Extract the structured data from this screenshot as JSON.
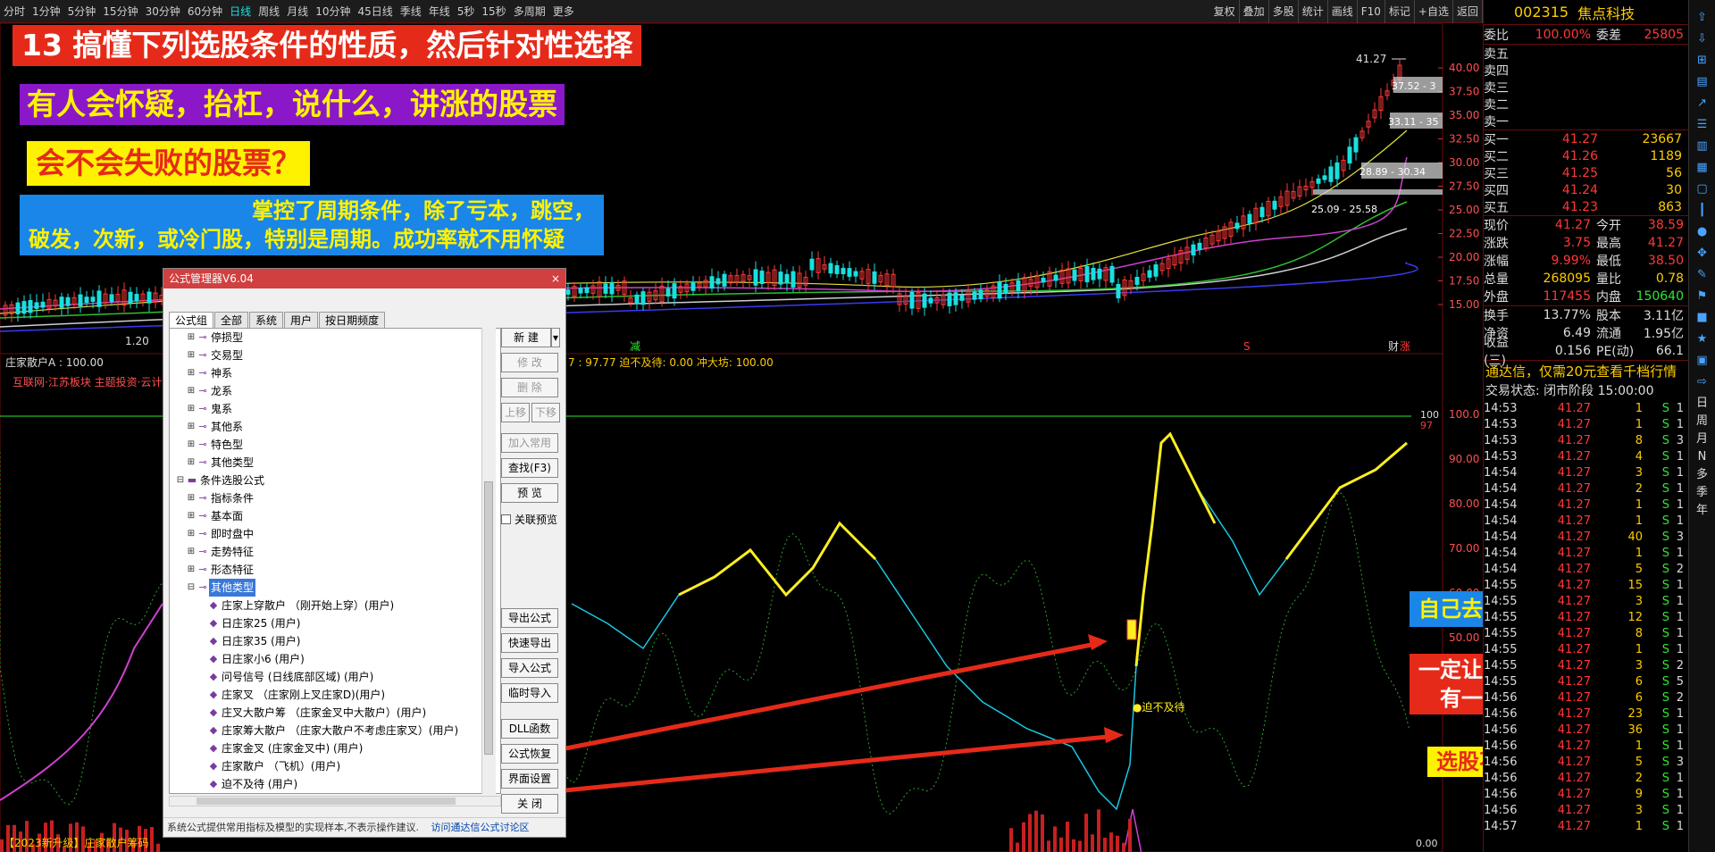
{
  "toolbar": {
    "periods": [
      "分时",
      "1分钟",
      "5分钟",
      "15分钟",
      "30分钟",
      "60分钟",
      "日线",
      "周线",
      "月线",
      "10分钟",
      "45日线",
      "季线",
      "年线",
      "5秒",
      "15秒",
      "多周期",
      "更多"
    ],
    "active_period": "日线",
    "right": [
      "复权",
      "叠加",
      "多股",
      "统计",
      "画线",
      "F10",
      "标记",
      "+自选",
      "返回"
    ]
  },
  "banners": {
    "b1": "13 搞懂下列选股条件的性质，然后针对性选择",
    "b2": "有人会怀疑，抬杠，说什么，讲涨的股票",
    "b3": "会不会失败的股票？",
    "b4_line1": "掌控了周期条件，除了亏本，跳空，",
    "b4_line2": "破发，次新，或冷门股，特别是周期。成功率就不用怀疑",
    "b5": "自己去下载  学习吧",
    "b6_line1": "一定让你对股票筹码",
    "b6_line2": "有一个全新的认识",
    "b7": "选股不再难！！！"
  },
  "chart_labels": {
    "price_axis": [
      "40.00",
      "37.50",
      "35.00",
      "32.50",
      "30.00",
      "27.50",
      "25.00",
      "22.50",
      "20.00",
      "17.50",
      "15.00"
    ],
    "osc_axis": [
      "100.0",
      "90.00",
      "80.00",
      "70.00",
      "60.00",
      "50.00"
    ],
    "high_label": "41.27",
    "zone1": "37.52 - 3",
    "zone2": "33.11 - 35",
    "zone3": "28.89 - 30.34",
    "zone4": "25.09 - 25.58",
    "low_label": "1.20",
    "indicator_name": "庄家散户A : 100.00",
    "indicator_values": "7 : 97.77   迫不及待: 0.00   冲大坊: 100.00",
    "sector": "互联网·江苏板块 主题投资·云计",
    "marker_jian": "减",
    "marker_s": "S",
    "marker_cai": "财",
    "marker_zhang": "涨",
    "annotation": "●迫不及待",
    "level_100": "100",
    "level_97": "97",
    "zero_label": "0.00",
    "bottom_tab": "【2023新升级】庄家散户筹码"
  },
  "dialog": {
    "title": "公式管理器V6.04",
    "close": "×",
    "tabs": [
      "公式组",
      "全部",
      "系统",
      "用户",
      "按日期频度"
    ],
    "tree": [
      {
        "label": "停损型",
        "level": 1,
        "type": "node"
      },
      {
        "label": "交易型",
        "level": 1,
        "type": "node"
      },
      {
        "label": "神系",
        "level": 1,
        "type": "node"
      },
      {
        "label": "龙系",
        "level": 1,
        "type": "node"
      },
      {
        "label": "鬼系",
        "level": 1,
        "type": "node"
      },
      {
        "label": "其他系",
        "level": 1,
        "type": "node"
      },
      {
        "label": "特色型",
        "level": 1,
        "type": "node"
      },
      {
        "label": "其他类型",
        "level": 1,
        "type": "node"
      },
      {
        "label": "条件选股公式",
        "level": 0,
        "type": "folder"
      },
      {
        "label": "指标条件",
        "level": 1,
        "type": "node"
      },
      {
        "label": "基本面",
        "level": 1,
        "type": "node"
      },
      {
        "label": "即时盘中",
        "level": 1,
        "type": "node"
      },
      {
        "label": "走势特征",
        "level": 1,
        "type": "node"
      },
      {
        "label": "形态特征",
        "level": 1,
        "type": "node"
      },
      {
        "label": "其他类型",
        "level": 1,
        "type": "node",
        "selected": true
      },
      {
        "label": "庄家上穿散户  （刚开始上穿）(用户)",
        "level": 2,
        "type": "leaf"
      },
      {
        "label": "日庄家25  (用户)",
        "level": 2,
        "type": "leaf"
      },
      {
        "label": "日庄家35  (用户)",
        "level": 2,
        "type": "leaf"
      },
      {
        "label": "日庄家小6  (用户)",
        "level": 2,
        "type": "leaf"
      },
      {
        "label": "问号信号  (日线底部区域)  (用户)",
        "level": 2,
        "type": "leaf"
      },
      {
        "label": "庄家叉  （庄家刚上叉庄家D)(用户)",
        "level": 2,
        "type": "leaf"
      },
      {
        "label": "庄叉大散户筹  （庄家金叉中大散户）(用户)",
        "level": 2,
        "type": "leaf"
      },
      {
        "label": "庄家筹大散户  （庄家大散户不考虑庄家叉）(用户)",
        "level": 2,
        "type": "leaf"
      },
      {
        "label": "庄家金叉  (庄家金叉中)  (用户)",
        "level": 2,
        "type": "leaf"
      },
      {
        "label": "庄家散户  （飞机）(用户)",
        "level": 2,
        "type": "leaf"
      },
      {
        "label": "迫不及待  (用户)",
        "level": 2,
        "type": "leaf"
      }
    ],
    "buttons": {
      "new": "新 建",
      "modify": "修 改",
      "delete": "删 除",
      "up": "上移",
      "down": "下移",
      "add_common": "加入常用",
      "find": "查找(F3)",
      "preview": "预 览",
      "link_preview": "关联预览",
      "export": "导出公式",
      "quick_export": "快速导出",
      "import": "导入公式",
      "temp_import": "临时导入",
      "dll": "DLL函数",
      "restore": "公式恢复",
      "ui_settings": "界面设置",
      "close": "关 闭"
    },
    "status_left": "系统公式提供常用指标及模型的实现样本,不表示操作建议.",
    "status_right": "访问通达信公式讨论区"
  },
  "side": {
    "code": "002315",
    "name": "焦点科技",
    "weibi_label": "委比",
    "weibi_value": "100.00%",
    "weicha_label": "委差",
    "weicha_value": "25805",
    "sells": [
      {
        "l": "卖五"
      },
      {
        "l": "卖四"
      },
      {
        "l": "卖三"
      },
      {
        "l": "卖二"
      },
      {
        "l": "卖一"
      }
    ],
    "buys": [
      {
        "l": "买一",
        "p": "41.27",
        "v": "23667"
      },
      {
        "l": "买二",
        "p": "41.26",
        "v": "1189"
      },
      {
        "l": "买三",
        "p": "41.25",
        "v": "56"
      },
      {
        "l": "买四",
        "p": "41.24",
        "v": "30"
      },
      {
        "l": "买五",
        "p": "41.23",
        "v": "863"
      }
    ],
    "stats": [
      {
        "a": "现价",
        "b": "41.27",
        "c": "今开",
        "d": "38.59"
      },
      {
        "a": "涨跌",
        "b": "3.75",
        "c": "最高",
        "d": "41.27"
      },
      {
        "a": "涨幅",
        "b": "9.99%",
        "c": "最低",
        "d": "38.50"
      },
      {
        "a": "总量",
        "b": "268095",
        "c": "量比",
        "d": "0.78"
      },
      {
        "a": "外盘",
        "b": "117455",
        "c": "内盘",
        "d": "150640"
      }
    ],
    "stats2": [
      {
        "a": "换手",
        "b": "13.77%",
        "c": "股本",
        "d": "3.11亿"
      },
      {
        "a": "净资",
        "b": "6.49",
        "c": "流通",
        "d": "1.95亿"
      },
      {
        "a": "收益(三)",
        "b": "0.156",
        "c": "PE(动)",
        "d": "66.1"
      }
    ],
    "notice": "通达信，仅需20元查看千档行情",
    "state": "交易状态: 闭市阶段 15:00:00",
    "ticks": [
      {
        "t": "14:53",
        "p": "41.27",
        "v": "1",
        "s": "S",
        "n": "1"
      },
      {
        "t": "14:53",
        "p": "41.27",
        "v": "1",
        "s": "S",
        "n": "1"
      },
      {
        "t": "14:53",
        "p": "41.27",
        "v": "8",
        "s": "S",
        "n": "3"
      },
      {
        "t": "14:53",
        "p": "41.27",
        "v": "4",
        "s": "S",
        "n": "1"
      },
      {
        "t": "14:54",
        "p": "41.27",
        "v": "3",
        "s": "S",
        "n": "1"
      },
      {
        "t": "14:54",
        "p": "41.27",
        "v": "2",
        "s": "S",
        "n": "1"
      },
      {
        "t": "14:54",
        "p": "41.27",
        "v": "1",
        "s": "S",
        "n": "1"
      },
      {
        "t": "14:54",
        "p": "41.27",
        "v": "1",
        "s": "S",
        "n": "1"
      },
      {
        "t": "14:54",
        "p": "41.27",
        "v": "40",
        "s": "S",
        "n": "3"
      },
      {
        "t": "14:54",
        "p": "41.27",
        "v": "1",
        "s": "S",
        "n": "1"
      },
      {
        "t": "14:54",
        "p": "41.27",
        "v": "5",
        "s": "S",
        "n": "2"
      },
      {
        "t": "14:55",
        "p": "41.27",
        "v": "15",
        "s": "S",
        "n": "1"
      },
      {
        "t": "14:55",
        "p": "41.27",
        "v": "3",
        "s": "S",
        "n": "1"
      },
      {
        "t": "14:55",
        "p": "41.27",
        "v": "12",
        "s": "S",
        "n": "1"
      },
      {
        "t": "14:55",
        "p": "41.27",
        "v": "8",
        "s": "S",
        "n": "1"
      },
      {
        "t": "14:55",
        "p": "41.27",
        "v": "1",
        "s": "S",
        "n": "1"
      },
      {
        "t": "14:55",
        "p": "41.27",
        "v": "3",
        "s": "S",
        "n": "2"
      },
      {
        "t": "14:55",
        "p": "41.27",
        "v": "6",
        "s": "S",
        "n": "5"
      },
      {
        "t": "14:56",
        "p": "41.27",
        "v": "6",
        "s": "S",
        "n": "2"
      },
      {
        "t": "14:56",
        "p": "41.27",
        "v": "23",
        "s": "S",
        "n": "1"
      },
      {
        "t": "14:56",
        "p": "41.27",
        "v": "36",
        "s": "S",
        "n": "1"
      },
      {
        "t": "14:56",
        "p": "41.27",
        "v": "1",
        "s": "S",
        "n": "1"
      },
      {
        "t": "14:56",
        "p": "41.27",
        "v": "5",
        "s": "S",
        "n": "3"
      },
      {
        "t": "14:56",
        "p": "41.27",
        "v": "2",
        "s": "S",
        "n": "1"
      },
      {
        "t": "14:56",
        "p": "41.27",
        "v": "9",
        "s": "S",
        "n": "1"
      },
      {
        "t": "14:56",
        "p": "41.27",
        "v": "3",
        "s": "S",
        "n": "1"
      },
      {
        "t": "14:57",
        "p": "41.27",
        "v": "1",
        "s": "S",
        "n": "1"
      }
    ]
  },
  "right_toolbar": [
    "日",
    "周",
    "月",
    "N",
    "多",
    "季",
    "年"
  ],
  "colors": {
    "accent_red": "#e62a19",
    "yellow": "#fff200",
    "blue": "#1a86e8",
    "purple": "#8a18c8",
    "up": "#ff3838",
    "down": "#19e0e0"
  }
}
